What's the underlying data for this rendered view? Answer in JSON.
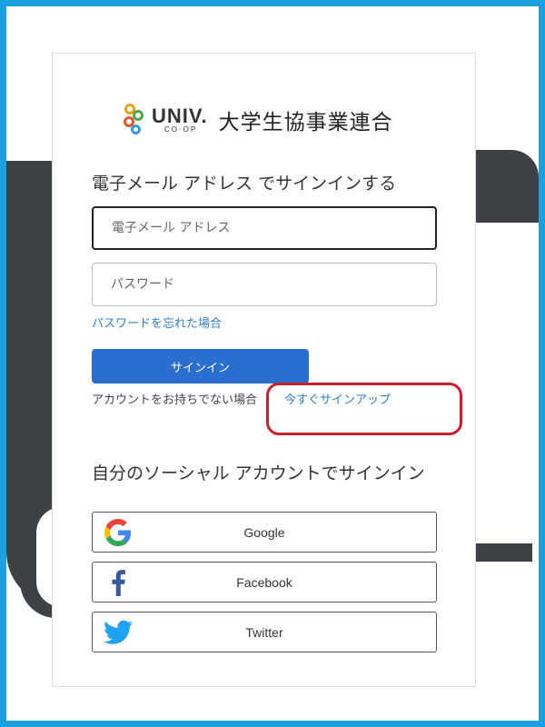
{
  "logo": {
    "univ": "UNIV.",
    "coop": "CO·OP",
    "org_name": "大学生協事業連合"
  },
  "signin": {
    "heading": "電子メール アドレス でサインインする",
    "email_placeholder": "電子メール アドレス",
    "password_placeholder": "パスワード",
    "forgot_password": "パスワードを忘れた場合",
    "button_label": "サインイン",
    "no_account_text": "アカウントをお持ちでない場合",
    "signup_link": "今すぐサインアップ"
  },
  "social": {
    "heading": "自分のソーシャル アカウントでサインイン",
    "providers": [
      {
        "label": "Google",
        "icon": "google-icon"
      },
      {
        "label": "Facebook",
        "icon": "facebook-icon"
      },
      {
        "label": "Twitter",
        "icon": "twitter-icon"
      }
    ]
  },
  "colors": {
    "frame": "#1ba1e2",
    "primary_button": "#2a6fcf",
    "link": "#2f80c0",
    "highlight": "#c8202a",
    "background_shape": "#3d4145"
  }
}
